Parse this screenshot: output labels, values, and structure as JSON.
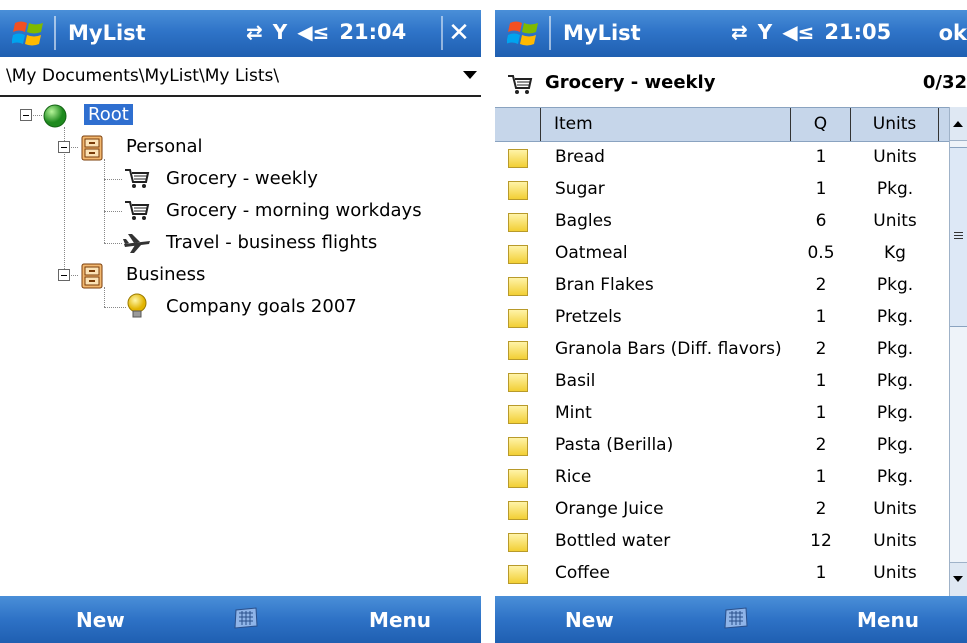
{
  "left": {
    "titlebar": {
      "title": "MyList",
      "time": "21:04",
      "close_label": "✕"
    },
    "path": "\\My Documents\\MyList\\My Lists\\",
    "tree": {
      "root": "Root",
      "personal": "Personal",
      "grocery_weekly": "Grocery - weekly",
      "grocery_morning": "Grocery - morning workdays",
      "travel": "Travel - business flights",
      "business": "Business",
      "goals": "Company goals 2007"
    },
    "softkeys": {
      "left": "New",
      "right": "Menu"
    }
  },
  "right": {
    "titlebar": {
      "title": "MyList",
      "time": "21:05",
      "ok_label": "ok"
    },
    "list": {
      "title": "Grocery - weekly",
      "count": "0/32"
    },
    "columns": {
      "item": "Item",
      "q": "Q",
      "units": "Units"
    },
    "rows": [
      {
        "item": "Bread",
        "q": "1",
        "units": "Units"
      },
      {
        "item": "Sugar",
        "q": "1",
        "units": "Pkg."
      },
      {
        "item": "Bagles",
        "q": "6",
        "units": "Units"
      },
      {
        "item": "Oatmeal",
        "q": "0.5",
        "units": "Kg"
      },
      {
        "item": "Bran Flakes",
        "q": "2",
        "units": "Pkg."
      },
      {
        "item": "Pretzels",
        "q": "1",
        "units": "Pkg."
      },
      {
        "item": "Granola Bars (Diff. flavors)",
        "q": "2",
        "units": "Pkg."
      },
      {
        "item": "Basil",
        "q": "1",
        "units": "Pkg."
      },
      {
        "item": "Mint",
        "q": "1",
        "units": "Pkg."
      },
      {
        "item": "Pasta (Berilla)",
        "q": "2",
        "units": "Pkg."
      },
      {
        "item": "Rice",
        "q": "1",
        "units": "Pkg."
      },
      {
        "item": "Orange Juice",
        "q": "2",
        "units": "Units"
      },
      {
        "item": "Bottled water",
        "q": "12",
        "units": "Units"
      },
      {
        "item": "Coffee",
        "q": "1",
        "units": "Units"
      }
    ],
    "softkeys": {
      "left": "New",
      "right": "Menu"
    }
  },
  "colors": {
    "titlebar": "#2f74c8",
    "selection": "#2f6fd0",
    "column_header": "#c6d6ea",
    "checkbox": "#f2cf34"
  }
}
